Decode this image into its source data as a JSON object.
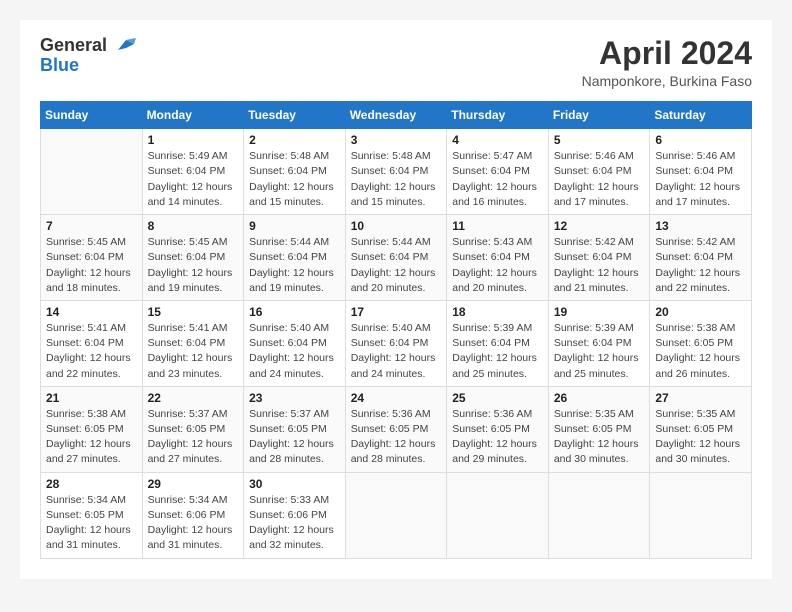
{
  "header": {
    "logo_line1": "General",
    "logo_line2": "Blue",
    "title": "April 2024",
    "subtitle": "Namponkore, Burkina Faso"
  },
  "weekdays": [
    "Sunday",
    "Monday",
    "Tuesday",
    "Wednesday",
    "Thursday",
    "Friday",
    "Saturday"
  ],
  "weeks": [
    [
      {
        "day": "",
        "info": ""
      },
      {
        "day": "1",
        "info": "Sunrise: 5:49 AM\nSunset: 6:04 PM\nDaylight: 12 hours\nand 14 minutes."
      },
      {
        "day": "2",
        "info": "Sunrise: 5:48 AM\nSunset: 6:04 PM\nDaylight: 12 hours\nand 15 minutes."
      },
      {
        "day": "3",
        "info": "Sunrise: 5:48 AM\nSunset: 6:04 PM\nDaylight: 12 hours\nand 15 minutes."
      },
      {
        "day": "4",
        "info": "Sunrise: 5:47 AM\nSunset: 6:04 PM\nDaylight: 12 hours\nand 16 minutes."
      },
      {
        "day": "5",
        "info": "Sunrise: 5:46 AM\nSunset: 6:04 PM\nDaylight: 12 hours\nand 17 minutes."
      },
      {
        "day": "6",
        "info": "Sunrise: 5:46 AM\nSunset: 6:04 PM\nDaylight: 12 hours\nand 17 minutes."
      }
    ],
    [
      {
        "day": "7",
        "info": "Sunrise: 5:45 AM\nSunset: 6:04 PM\nDaylight: 12 hours\nand 18 minutes."
      },
      {
        "day": "8",
        "info": "Sunrise: 5:45 AM\nSunset: 6:04 PM\nDaylight: 12 hours\nand 19 minutes."
      },
      {
        "day": "9",
        "info": "Sunrise: 5:44 AM\nSunset: 6:04 PM\nDaylight: 12 hours\nand 19 minutes."
      },
      {
        "day": "10",
        "info": "Sunrise: 5:44 AM\nSunset: 6:04 PM\nDaylight: 12 hours\nand 20 minutes."
      },
      {
        "day": "11",
        "info": "Sunrise: 5:43 AM\nSunset: 6:04 PM\nDaylight: 12 hours\nand 20 minutes."
      },
      {
        "day": "12",
        "info": "Sunrise: 5:42 AM\nSunset: 6:04 PM\nDaylight: 12 hours\nand 21 minutes."
      },
      {
        "day": "13",
        "info": "Sunrise: 5:42 AM\nSunset: 6:04 PM\nDaylight: 12 hours\nand 22 minutes."
      }
    ],
    [
      {
        "day": "14",
        "info": "Sunrise: 5:41 AM\nSunset: 6:04 PM\nDaylight: 12 hours\nand 22 minutes."
      },
      {
        "day": "15",
        "info": "Sunrise: 5:41 AM\nSunset: 6:04 PM\nDaylight: 12 hours\nand 23 minutes."
      },
      {
        "day": "16",
        "info": "Sunrise: 5:40 AM\nSunset: 6:04 PM\nDaylight: 12 hours\nand 24 minutes."
      },
      {
        "day": "17",
        "info": "Sunrise: 5:40 AM\nSunset: 6:04 PM\nDaylight: 12 hours\nand 24 minutes."
      },
      {
        "day": "18",
        "info": "Sunrise: 5:39 AM\nSunset: 6:04 PM\nDaylight: 12 hours\nand 25 minutes."
      },
      {
        "day": "19",
        "info": "Sunrise: 5:39 AM\nSunset: 6:04 PM\nDaylight: 12 hours\nand 25 minutes."
      },
      {
        "day": "20",
        "info": "Sunrise: 5:38 AM\nSunset: 6:05 PM\nDaylight: 12 hours\nand 26 minutes."
      }
    ],
    [
      {
        "day": "21",
        "info": "Sunrise: 5:38 AM\nSunset: 6:05 PM\nDaylight: 12 hours\nand 27 minutes."
      },
      {
        "day": "22",
        "info": "Sunrise: 5:37 AM\nSunset: 6:05 PM\nDaylight: 12 hours\nand 27 minutes."
      },
      {
        "day": "23",
        "info": "Sunrise: 5:37 AM\nSunset: 6:05 PM\nDaylight: 12 hours\nand 28 minutes."
      },
      {
        "day": "24",
        "info": "Sunrise: 5:36 AM\nSunset: 6:05 PM\nDaylight: 12 hours\nand 28 minutes."
      },
      {
        "day": "25",
        "info": "Sunrise: 5:36 AM\nSunset: 6:05 PM\nDaylight: 12 hours\nand 29 minutes."
      },
      {
        "day": "26",
        "info": "Sunrise: 5:35 AM\nSunset: 6:05 PM\nDaylight: 12 hours\nand 30 minutes."
      },
      {
        "day": "27",
        "info": "Sunrise: 5:35 AM\nSunset: 6:05 PM\nDaylight: 12 hours\nand 30 minutes."
      }
    ],
    [
      {
        "day": "28",
        "info": "Sunrise: 5:34 AM\nSunset: 6:05 PM\nDaylight: 12 hours\nand 31 minutes."
      },
      {
        "day": "29",
        "info": "Sunrise: 5:34 AM\nSunset: 6:06 PM\nDaylight: 12 hours\nand 31 minutes."
      },
      {
        "day": "30",
        "info": "Sunrise: 5:33 AM\nSunset: 6:06 PM\nDaylight: 12 hours\nand 32 minutes."
      },
      {
        "day": "",
        "info": ""
      },
      {
        "day": "",
        "info": ""
      },
      {
        "day": "",
        "info": ""
      },
      {
        "day": "",
        "info": ""
      }
    ]
  ]
}
